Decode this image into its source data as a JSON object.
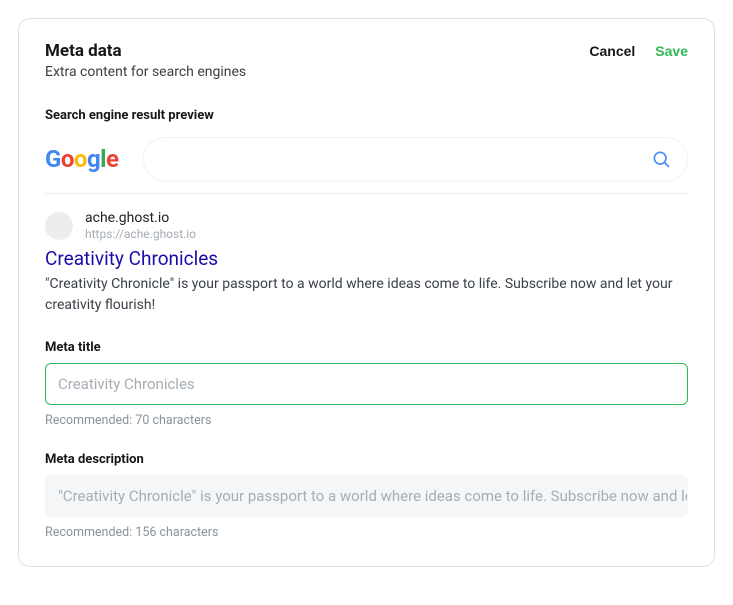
{
  "header": {
    "title": "Meta data",
    "subtitle": "Extra content for search engines",
    "cancel_label": "Cancel",
    "save_label": "Save"
  },
  "preview": {
    "section_label": "Search engine result preview",
    "domain": "ache.ghost.io",
    "url": "https://ache.ghost.io",
    "title": "Creativity Chronicles",
    "description": "\"Creativity Chronicle\" is your passport to a world where ideas come to life. Subscribe now and let your creativity flourish!"
  },
  "meta_title": {
    "label": "Meta title",
    "value": "",
    "placeholder": "Creativity Chronicles",
    "helper": "Recommended: 70 characters"
  },
  "meta_description": {
    "label": "Meta description",
    "value": "",
    "placeholder": "\"Creativity Chronicle\" is your passport to a world where ideas come to life. Subscribe now and let your creativity flourish!",
    "helper": "Recommended: 156 characters"
  }
}
